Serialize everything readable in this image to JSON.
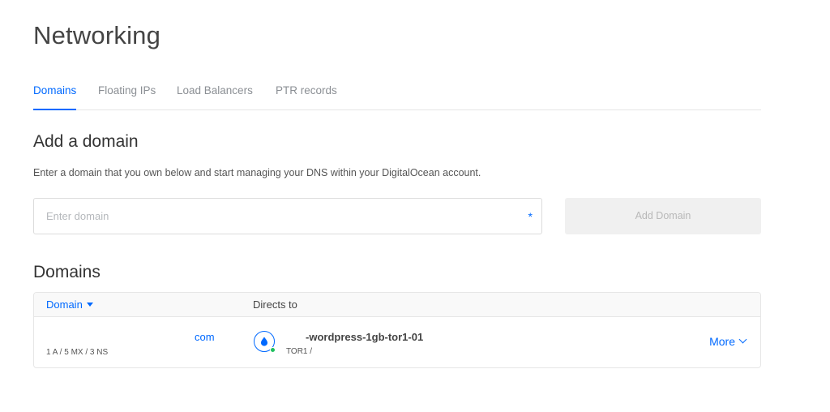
{
  "page": {
    "title": "Networking"
  },
  "tabs": [
    {
      "label": "Domains",
      "active": true
    },
    {
      "label": "Floating IPs",
      "active": false
    },
    {
      "label": "Load Balancers",
      "active": false
    },
    {
      "label": "PTR records",
      "active": false
    }
  ],
  "add_domain": {
    "title": "Add a domain",
    "helper": "Enter a domain that you own below and start managing your DNS within your DigitalOcean account.",
    "input_value": "",
    "input_placeholder": "Enter domain",
    "required_marker": "*",
    "button_label": "Add Domain"
  },
  "domains": {
    "title": "Domains",
    "columns": {
      "domain": "Domain",
      "directs_to": "Directs to"
    },
    "rows": [
      {
        "domain": "com",
        "records": "1 A / 5 MX / 3 NS",
        "droplet_name": "-wordpress-1gb-tor1-01",
        "droplet_region": "TOR1 /",
        "more_label": "More"
      }
    ]
  },
  "colors": {
    "accent": "#0069ff",
    "status_online": "#1fbf5f",
    "disabled_button": "#f0f0f0"
  },
  "icons": {
    "droplet": "droplet-icon",
    "sort": "caret-down-icon",
    "more": "chevron-down-icon"
  }
}
